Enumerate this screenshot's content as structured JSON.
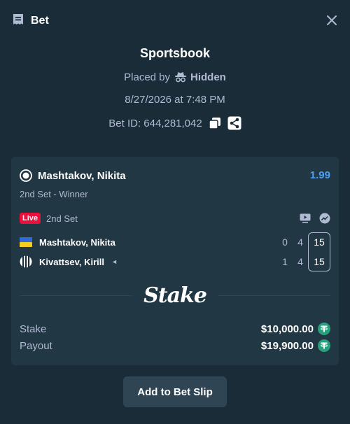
{
  "header": {
    "title": "Bet",
    "icon": "bet-slip-icon",
    "close_icon": "close-icon"
  },
  "info": {
    "book": "Sportsbook",
    "placed_by_label": "Placed by",
    "user": "Hidden",
    "datetime": "8/27/2026 at 7:48 PM",
    "bet_id": "Bet ID: 644,281,042"
  },
  "selection": {
    "name": "Mashtakov, Nikita",
    "odds": "1.99",
    "market": "2nd Set - Winner",
    "live_badge": "Live",
    "period": "2nd Set",
    "players": [
      {
        "name": "Mashtakov, Nikita",
        "flag": "ukraine",
        "scores": [
          "0",
          "4"
        ],
        "current": "15",
        "serving": false
      },
      {
        "name": "Kivattsev, Kirill",
        "flag": "neutral-stripes",
        "scores": [
          "1",
          "4"
        ],
        "current": "15",
        "serving": true
      }
    ],
    "serve_marker": "◄"
  },
  "brand": "Stake",
  "summary": {
    "stake_label": "Stake",
    "stake_value": "$10,000.00",
    "payout_label": "Payout",
    "payout_value": "$19,900.00",
    "currency_icon": "tether-icon"
  },
  "actions": {
    "add_label": "Add to Bet Slip"
  },
  "colors": {
    "background": "#1a2c38",
    "card": "#213743",
    "text_muted": "#b1bad3",
    "odds": "#4f9ef5",
    "live": "#e9113c",
    "tether": "#26a17b",
    "button": "#2f4553"
  }
}
